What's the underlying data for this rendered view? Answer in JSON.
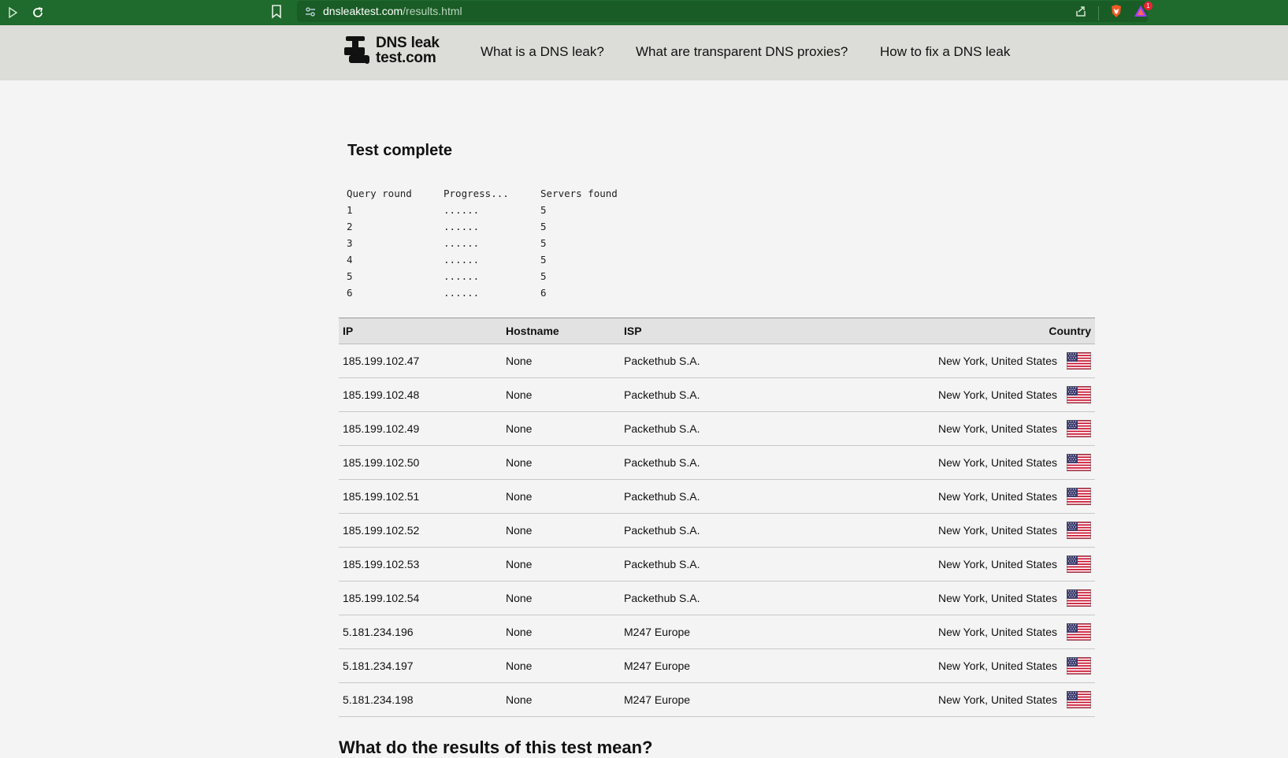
{
  "browser": {
    "url_host": "dnsleaktest.com",
    "url_path": "/results.html",
    "notification_count": "1"
  },
  "site": {
    "logo_line1": "DNS leak",
    "logo_line2": "test.com",
    "nav": [
      "What is a DNS leak?",
      "What are transparent DNS proxies?",
      "How to fix a DNS leak"
    ]
  },
  "main": {
    "title": "Test complete",
    "progress_headers": [
      "Query round",
      "Progress...",
      "Servers found"
    ],
    "progress_rows": [
      {
        "round": "1",
        "progress": "......",
        "found": "5"
      },
      {
        "round": "2",
        "progress": "......",
        "found": "5"
      },
      {
        "round": "3",
        "progress": "......",
        "found": "5"
      },
      {
        "round": "4",
        "progress": "......",
        "found": "5"
      },
      {
        "round": "5",
        "progress": "......",
        "found": "5"
      },
      {
        "round": "6",
        "progress": "......",
        "found": "6"
      }
    ],
    "table_headers": [
      "IP",
      "Hostname",
      "ISP",
      "Country"
    ],
    "table_rows": [
      {
        "ip": "185.199.102.47",
        "hostname": "None",
        "isp": "Packethub S.A.",
        "country": "New York, United States",
        "flag": "us-flag-icon"
      },
      {
        "ip": "185.199.102.48",
        "hostname": "None",
        "isp": "Packethub S.A.",
        "country": "New York, United States",
        "flag": "us-flag-icon"
      },
      {
        "ip": "185.199.102.49",
        "hostname": "None",
        "isp": "Packethub S.A.",
        "country": "New York, United States",
        "flag": "us-flag-icon"
      },
      {
        "ip": "185.199.102.50",
        "hostname": "None",
        "isp": "Packethub S.A.",
        "country": "New York, United States",
        "flag": "us-flag-icon"
      },
      {
        "ip": "185.199.102.51",
        "hostname": "None",
        "isp": "Packethub S.A.",
        "country": "New York, United States",
        "flag": "us-flag-icon"
      },
      {
        "ip": "185.199.102.52",
        "hostname": "None",
        "isp": "Packethub S.A.",
        "country": "New York, United States",
        "flag": "us-flag-icon"
      },
      {
        "ip": "185.199.102.53",
        "hostname": "None",
        "isp": "Packethub S.A.",
        "country": "New York, United States",
        "flag": "us-flag-icon"
      },
      {
        "ip": "185.199.102.54",
        "hostname": "None",
        "isp": "Packethub S.A.",
        "country": "New York, United States",
        "flag": "us-flag-icon"
      },
      {
        "ip": "5.181.234.196",
        "hostname": "None",
        "isp": "M247 Europe",
        "country": "New York, United States",
        "flag": "us-flag-icon"
      },
      {
        "ip": "5.181.234.197",
        "hostname": "None",
        "isp": "M247 Europe",
        "country": "New York, United States",
        "flag": "us-flag-icon"
      },
      {
        "ip": "5.181.234.198",
        "hostname": "None",
        "isp": "M247 Europe",
        "country": "New York, United States",
        "flag": "us-flag-icon"
      }
    ],
    "footer_heading": "What do the results of this test mean?"
  },
  "colors": {
    "chrome_bg": "#1f6a2d",
    "header_bg": "#dcdcd8",
    "page_bg": "#f4f4f4",
    "table_header_bg": "#e2e2e2"
  }
}
